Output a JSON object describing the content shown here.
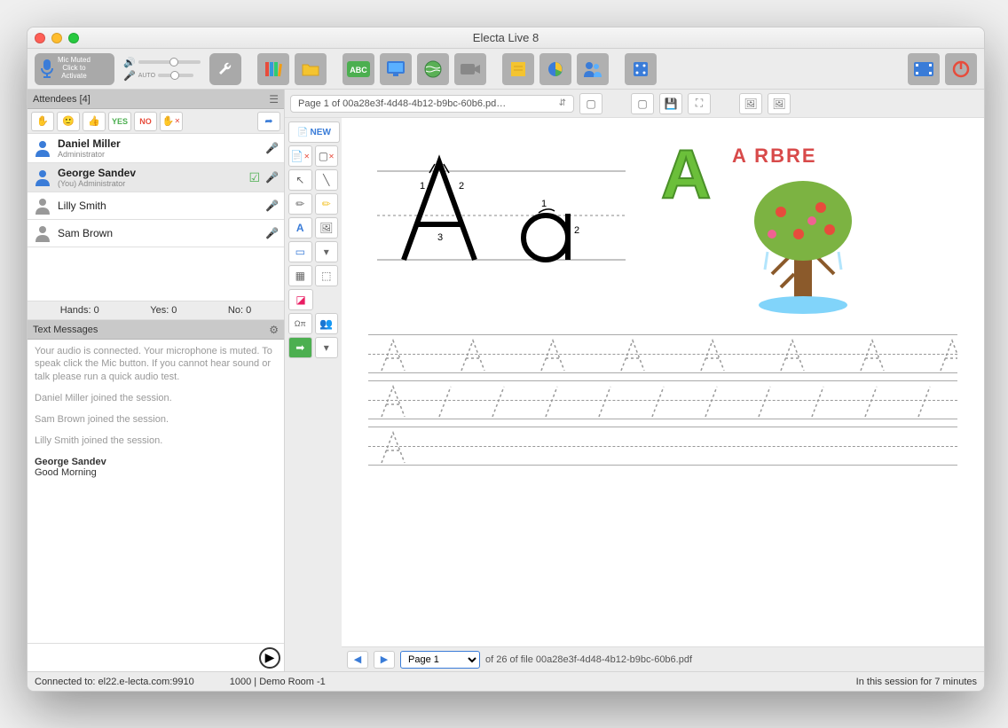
{
  "window_title": "Electa Live 8",
  "mic": {
    "status_line1": "Mic Muted",
    "status_line2": "Click to",
    "status_line3": "Activate",
    "auto": "AUTO"
  },
  "attendees": {
    "header": "Attendees [4]",
    "feedback_yes": "YES",
    "feedback_no": "NO",
    "list": [
      {
        "name": "Daniel Miller",
        "role": "Administrator",
        "bold": true,
        "color": "#3a7cd8"
      },
      {
        "name": "George Sandev",
        "role": "(You) Administrator",
        "bold": true,
        "color": "#3a7cd8",
        "check": true,
        "selected": true
      },
      {
        "name": "Lilly Smith",
        "role": "",
        "bold": false,
        "color": "#999"
      },
      {
        "name": "Sam Brown",
        "role": "",
        "bold": false,
        "color": "#999"
      }
    ],
    "stats": {
      "hands": "Hands: 0",
      "yes": "Yes: 0",
      "no": "No: 0"
    }
  },
  "chat": {
    "header": "Text Messages",
    "system_msg": "Your audio is connected. Your microphone is muted. To speak click the Mic button. If you cannot hear sound or talk please run a quick audio test.",
    "join1": "Daniel Miller joined the session.",
    "join2": "Sam Brown joined the session.",
    "join3": "Lilly Smith joined the session.",
    "msg_from": "George Sandev",
    "msg_body": "Good Morning"
  },
  "palette": {
    "new_label": "NEW",
    "omega": "Ωπ"
  },
  "whiteboard": {
    "page_label": "Page 1 of 00a28e3f-4d48-4b12-b9bc-60b6.pd…",
    "arbre": "A RBRE",
    "footer_page": "Page 1",
    "footer_info": "of 26 of file 00a28e3f-4d48-4b12-b9bc-60b6.pdf"
  },
  "status": {
    "left": "Connected to: el22.e-lecta.com:9910",
    "mid": "1000 | Demo Room -1",
    "right": "In this session for 7 minutes"
  }
}
